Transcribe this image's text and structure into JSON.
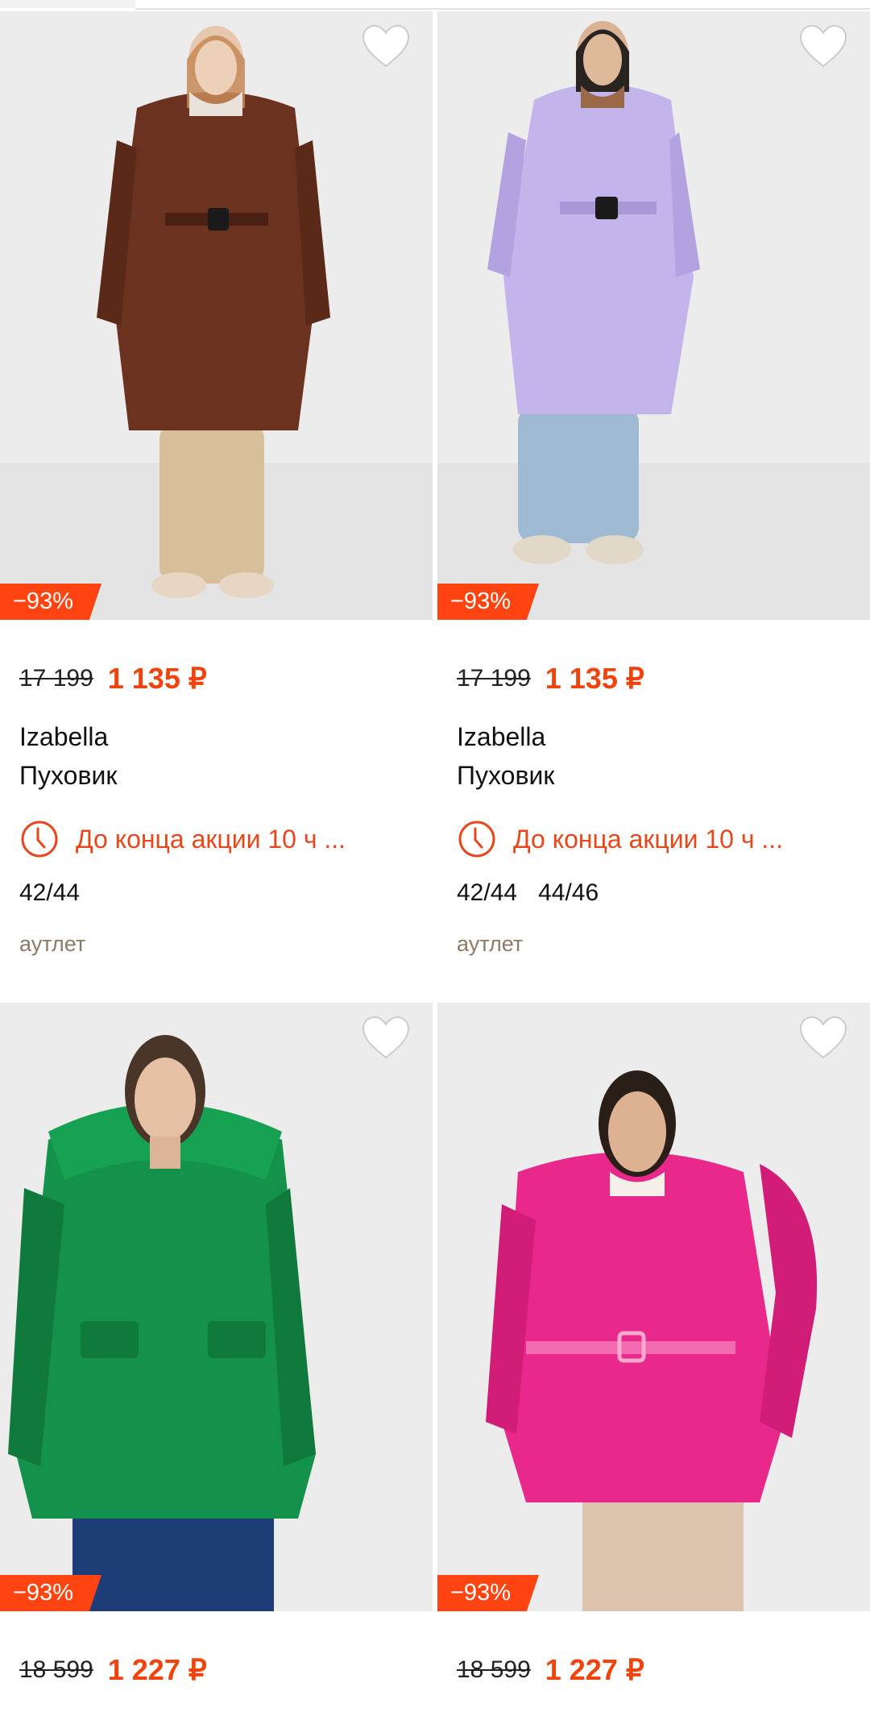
{
  "colors": {
    "accent": "#f0440f",
    "discount_bg": "#ff4411",
    "tag": "#8c7a66",
    "text": "#111111"
  },
  "products": [
    {
      "discount": "−93%",
      "old_price": "17 199",
      "new_price": "1 135 ₽",
      "brand": "Izabella",
      "kind": "Пуховик",
      "promo": "До конца акции 10 ч ...",
      "sizes": [
        "42/44"
      ],
      "tag": "аутлет",
      "favorite_icon": "heart-outline-icon",
      "promo_icon": "clock-icon",
      "coat_color": "#6b3220"
    },
    {
      "discount": "−93%",
      "old_price": "17 199",
      "new_price": "1 135 ₽",
      "brand": "Izabella",
      "kind": "Пуховик",
      "promo": "До конца акции 10 ч ...",
      "sizes": [
        "42/44",
        "44/46"
      ],
      "tag": "аутлет",
      "favorite_icon": "heart-outline-icon",
      "promo_icon": "clock-icon",
      "coat_color": "#c4b4ec"
    },
    {
      "discount": "−93%",
      "old_price": "18 599",
      "new_price": "1 227 ₽",
      "favorite_icon": "heart-outline-icon",
      "coat_color": "#14914a"
    },
    {
      "discount": "−93%",
      "old_price": "18 599",
      "new_price": "1 227 ₽",
      "favorite_icon": "heart-outline-icon",
      "coat_color": "#e8288a"
    }
  ]
}
